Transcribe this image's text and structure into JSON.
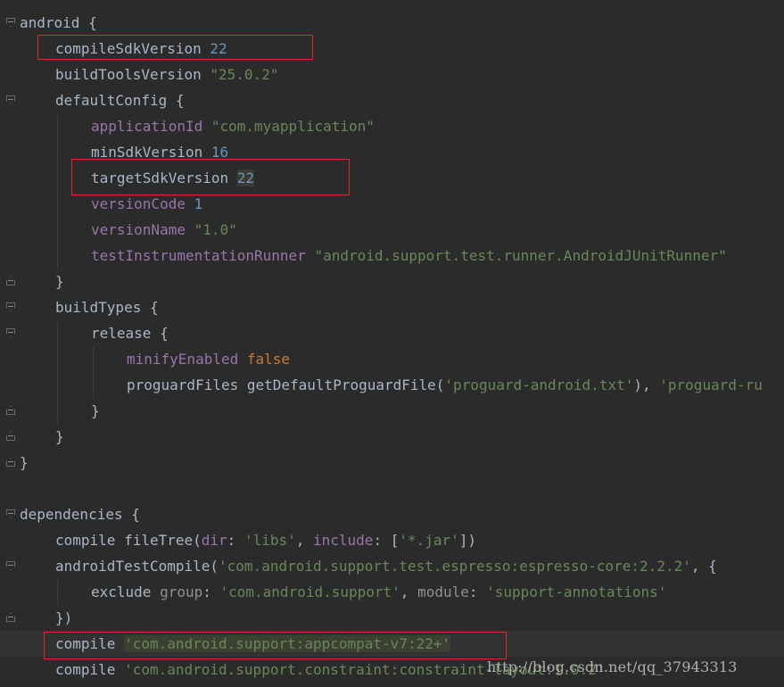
{
  "code_lines": [
    {
      "indent": 0,
      "fold": "open",
      "tokens": [
        {
          "t": "android {",
          "c": "plain"
        }
      ]
    },
    {
      "indent": 1,
      "tokens": [
        {
          "t": "compileSdkVersion ",
          "c": "plain"
        },
        {
          "t": "22",
          "c": "num"
        }
      ]
    },
    {
      "indent": 1,
      "tokens": [
        {
          "t": "buildToolsVersion ",
          "c": "plain"
        },
        {
          "t": "\"25.0.2\"",
          "c": "str"
        }
      ]
    },
    {
      "indent": 1,
      "fold": "open",
      "tokens": [
        {
          "t": "defaultConfig {",
          "c": "plain"
        }
      ]
    },
    {
      "indent": 2,
      "tokens": [
        {
          "t": "applicationId ",
          "c": "prop"
        },
        {
          "t": "\"com.myapplication\"",
          "c": "str"
        }
      ]
    },
    {
      "indent": 2,
      "tokens": [
        {
          "t": "minSdkVersion ",
          "c": "plain"
        },
        {
          "t": "16",
          "c": "num"
        }
      ]
    },
    {
      "indent": 2,
      "tokens": [
        {
          "t": "targetSdkVersion ",
          "c": "plain"
        },
        {
          "t": "22",
          "c": "num",
          "hl": true
        }
      ]
    },
    {
      "indent": 2,
      "tokens": [
        {
          "t": "versionCode ",
          "c": "prop"
        },
        {
          "t": "1",
          "c": "num"
        }
      ]
    },
    {
      "indent": 2,
      "tokens": [
        {
          "t": "versionName ",
          "c": "prop"
        },
        {
          "t": "\"1.0\"",
          "c": "str"
        }
      ]
    },
    {
      "indent": 2,
      "tokens": [
        {
          "t": "testInstrumentationRunner ",
          "c": "prop"
        },
        {
          "t": "\"android.support.test.runner.AndroidJUnitRunner\"",
          "c": "str"
        }
      ]
    },
    {
      "indent": 1,
      "fold": "close",
      "tokens": [
        {
          "t": "}",
          "c": "plain"
        }
      ]
    },
    {
      "indent": 1,
      "fold": "open",
      "tokens": [
        {
          "t": "buildTypes {",
          "c": "plain"
        }
      ]
    },
    {
      "indent": 2,
      "fold": "open",
      "tokens": [
        {
          "t": "release {",
          "c": "plain"
        }
      ]
    },
    {
      "indent": 3,
      "tokens": [
        {
          "t": "minifyEnabled ",
          "c": "prop"
        },
        {
          "t": "false",
          "c": "kw"
        }
      ]
    },
    {
      "indent": 3,
      "tokens": [
        {
          "t": "proguardFiles getDefaultProguardFile(",
          "c": "plain"
        },
        {
          "t": "'proguard-android.txt'",
          "c": "str"
        },
        {
          "t": "), ",
          "c": "plain"
        },
        {
          "t": "'proguard-ru",
          "c": "str"
        }
      ]
    },
    {
      "indent": 2,
      "fold": "close",
      "tokens": [
        {
          "t": "}",
          "c": "plain"
        }
      ]
    },
    {
      "indent": 1,
      "fold": "close",
      "tokens": [
        {
          "t": "}",
          "c": "plain"
        }
      ]
    },
    {
      "indent": 0,
      "fold": "close",
      "tokens": [
        {
          "t": "}",
          "c": "plain"
        }
      ]
    },
    {
      "indent": 0,
      "tokens": []
    },
    {
      "indent": 0,
      "fold": "open",
      "tokens": [
        {
          "t": "dependencies {",
          "c": "plain"
        }
      ]
    },
    {
      "indent": 1,
      "tokens": [
        {
          "t": "compile fileTree(",
          "c": "plain"
        },
        {
          "t": "dir",
          "c": "prop"
        },
        {
          "t": ": ",
          "c": "plain"
        },
        {
          "t": "'libs'",
          "c": "str"
        },
        {
          "t": ", ",
          "c": "plain"
        },
        {
          "t": "include",
          "c": "prop"
        },
        {
          "t": ": [",
          "c": "plain"
        },
        {
          "t": "'*.jar'",
          "c": "str"
        },
        {
          "t": "])",
          "c": "plain"
        }
      ]
    },
    {
      "indent": 1,
      "fold": "open",
      "tokens": [
        {
          "t": "androidTestCompile(",
          "c": "plain"
        },
        {
          "t": "'com.android.support.test.espresso:espresso-core:2.2.2'",
          "c": "str"
        },
        {
          "t": ", {",
          "c": "plain"
        }
      ]
    },
    {
      "indent": 2,
      "tokens": [
        {
          "t": "exclude ",
          "c": "plain"
        },
        {
          "t": "group",
          "c": "arg"
        },
        {
          "t": ": ",
          "c": "plain"
        },
        {
          "t": "'com.android.support'",
          "c": "str"
        },
        {
          "t": ", ",
          "c": "plain"
        },
        {
          "t": "module",
          "c": "arg"
        },
        {
          "t": ": ",
          "c": "plain"
        },
        {
          "t": "'support-annotations'",
          "c": "str"
        }
      ]
    },
    {
      "indent": 1,
      "fold": "close",
      "tokens": [
        {
          "t": "})",
          "c": "plain"
        }
      ]
    },
    {
      "indent": 1,
      "caret": true,
      "tokens": [
        {
          "t": "compile ",
          "c": "plain"
        },
        {
          "t": "'com.android.support:appcompat-v7:22+'",
          "c": "str",
          "hl": true
        }
      ]
    },
    {
      "indent": 1,
      "tokens": [
        {
          "t": "compile ",
          "c": "plain"
        },
        {
          "t": "'com.android.support.constraint:constraint-layout:1.0.2'",
          "c": "str"
        }
      ]
    }
  ],
  "watermark": "http://blog.csdn.net/qq_37943313",
  "colors": {
    "background": "#2b2b2b",
    "plain": "#a9b7c6",
    "number": "#6897bb",
    "string": "#6a8759",
    "property": "#9876aa",
    "keyword": "#cc7832",
    "annotation_box": "#e0272e"
  }
}
